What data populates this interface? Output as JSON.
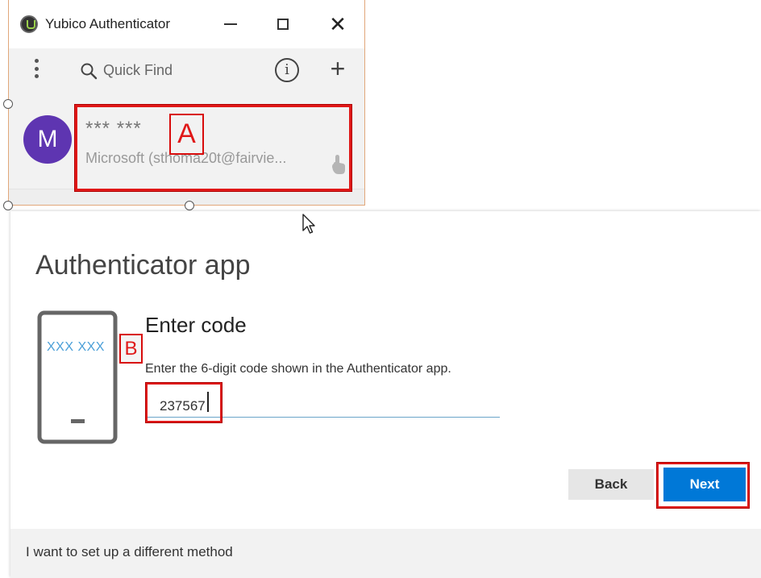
{
  "yubico": {
    "window_title": "Yubico Authenticator",
    "close_glyph": "✕",
    "search_placeholder": "Quick Find",
    "info_glyph": "i",
    "add_glyph": "+",
    "credential": {
      "avatar_letter": "M",
      "code": "*** ***",
      "issuer": "Microsoft (sthoma20t@fairvie..."
    },
    "avatar_color": "#5e35b1"
  },
  "annotations": {
    "label_a": "A",
    "label_b": "B",
    "color": "#e01818"
  },
  "authenticator": {
    "title": "Authenticator app",
    "phone_code": "XXX XXX",
    "heading": "Enter code",
    "instructions": "Enter the 6-digit code shown in the Authenticator app.",
    "code_value": "237567",
    "back_label": "Back",
    "next_label": "Next",
    "different_method_label": "I want to set up a different method",
    "accent_color": "#0078d7"
  },
  "icons": [
    "app-logo-icon",
    "kebab-menu-icon",
    "search-icon",
    "info-icon",
    "add-icon",
    "touch-icon",
    "phone-icon",
    "mouse-cursor-icon"
  ]
}
